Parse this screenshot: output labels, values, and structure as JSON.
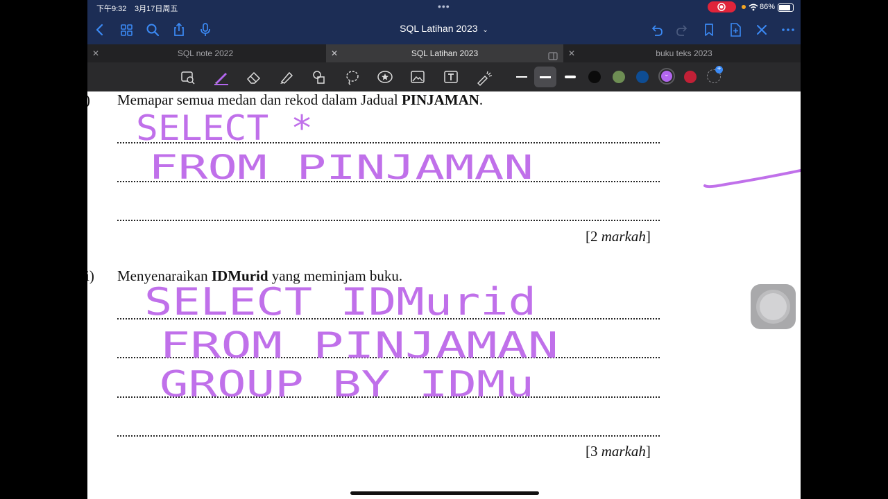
{
  "status_bar": {
    "time": "下午9:32",
    "date": "3月17日周五",
    "battery": "86%"
  },
  "nav": {
    "title": "SQL Latihan 2023"
  },
  "tabs": [
    {
      "label": "SQL note 2022"
    },
    {
      "label": "SQL Latihan 2023"
    },
    {
      "label": "buku teks 2023"
    }
  ],
  "toolbar": {
    "colors": [
      "#0b0b0b",
      "#6e8e54",
      "#0e4d94",
      "#b266ee",
      "#c22036"
    ],
    "selected_color": "#b266ee"
  },
  "document": {
    "q1": {
      "marker": ")",
      "text_before": "Memapar semua medan dan rekod dalam Jadual ",
      "text_bold": "PINJAMAN",
      "text_after": ".",
      "marks_prefix": "[2 ",
      "marks_italic": "markah",
      "marks_suffix": "]"
    },
    "q2": {
      "marker": "i)",
      "text_before": "Menyenaraikan ",
      "text_bold": "IDMurid",
      "text_after": " yang meminjam buku.",
      "marks_prefix": "[3 ",
      "marks_italic": "markah",
      "marks_suffix": "]"
    }
  },
  "handwriting": {
    "answer1": [
      "SELECT *",
      "FROM PINJAMAN"
    ],
    "answer2": [
      "SELECT IDMurid",
      "FROM PINJAMAN",
      "GROUP BY IDMu"
    ]
  }
}
